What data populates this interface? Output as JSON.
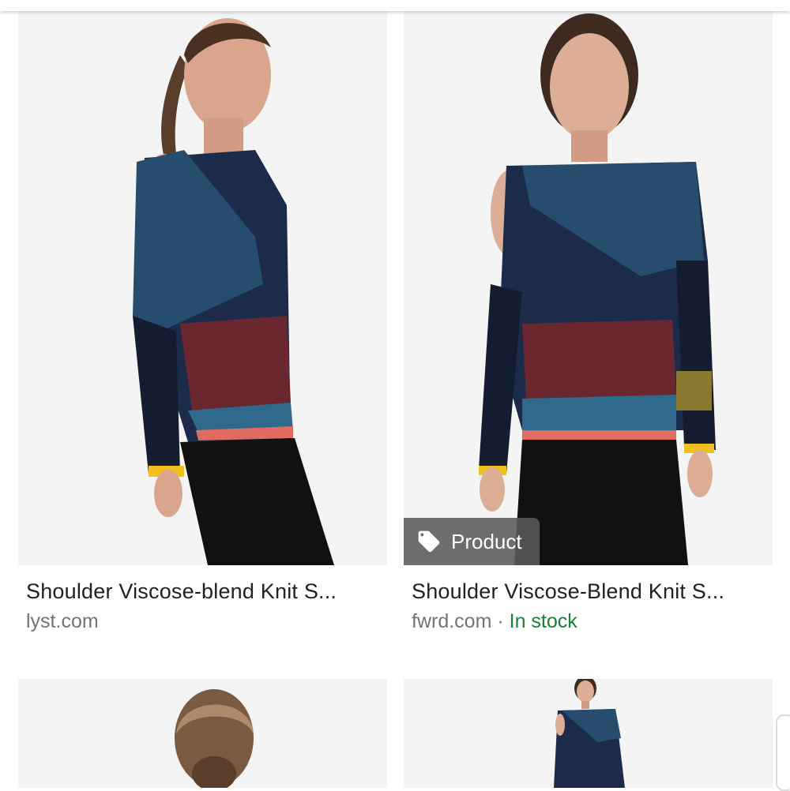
{
  "results": [
    {
      "title": "Shoulder Viscose-blend Knit S...",
      "source": "lyst.com",
      "stock": "",
      "badge": ""
    },
    {
      "title": "Shoulder Viscose-Blend Knit S...",
      "source": "fwrd.com",
      "separator": " · ",
      "stock": "In stock",
      "badge": "Product"
    }
  ],
  "icons": {
    "badge_icon": "tag-icon"
  },
  "colors": {
    "title": "#202124",
    "source": "#70757a",
    "stock": "#188038",
    "badge_bg": "#5a5a5a"
  }
}
